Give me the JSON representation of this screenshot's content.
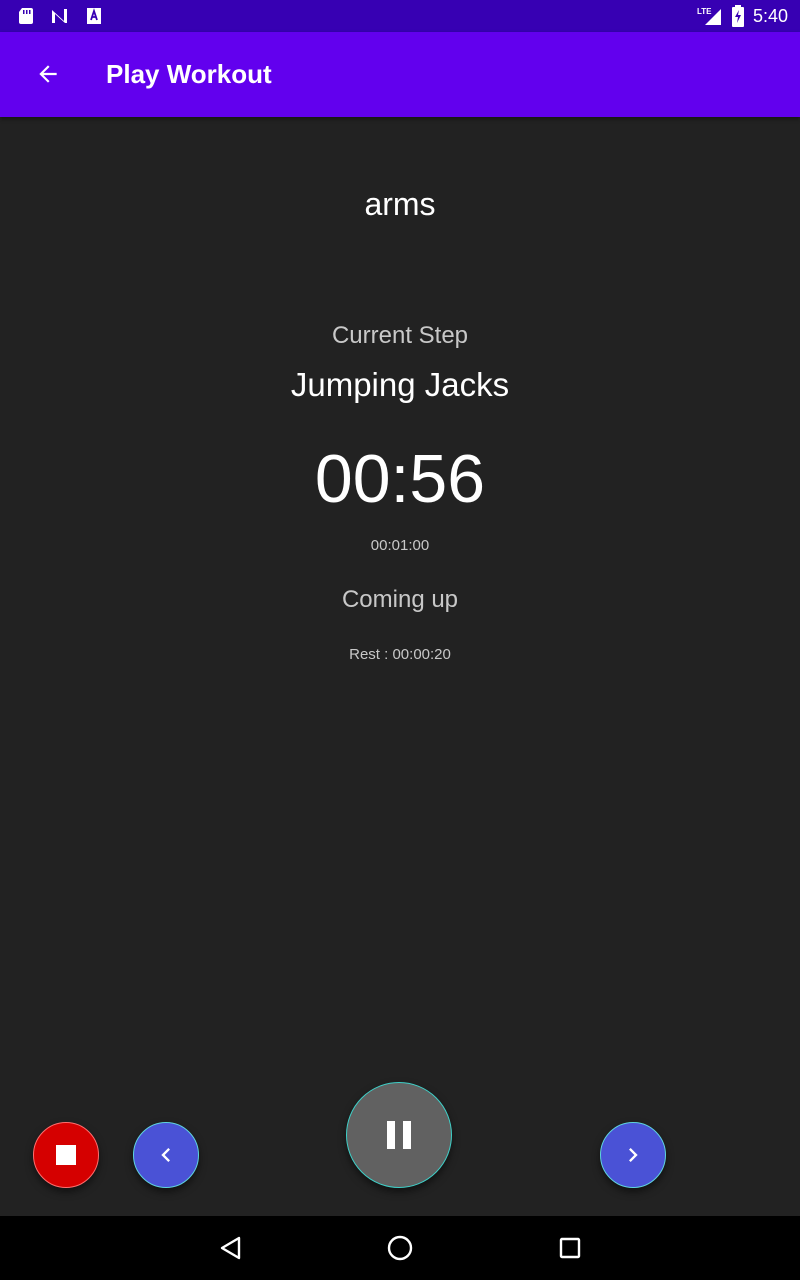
{
  "status_bar": {
    "time": "5:40",
    "network_label": "LTE",
    "icons": [
      "sd-card-icon",
      "n-logo-icon",
      "font-a-icon",
      "signal-icon",
      "battery-charging-icon"
    ]
  },
  "app_bar": {
    "title": "Play Workout",
    "back_icon": "arrow-back-icon"
  },
  "workout": {
    "name": "arms",
    "current_step_label": "Current Step",
    "current_step": "Jumping Jacks",
    "timer": "00:56",
    "step_duration": "00:01:00",
    "coming_up_label": "Coming up",
    "next_step": "Rest : 00:00:20"
  },
  "controls": {
    "stop_icon": "stop-icon",
    "previous_icon": "chevron-left-icon",
    "pause_icon": "pause-icon",
    "next_icon": "chevron-right-icon",
    "colors": {
      "stop": "#d50000",
      "nav": "#4a52d6",
      "pause": "#616161",
      "app_bar": "#6200ee",
      "status_bar": "#3700b3",
      "background": "#222222"
    }
  },
  "nav_bar": {
    "icons": [
      "back-triangle-icon",
      "home-circle-icon",
      "recents-square-icon"
    ]
  }
}
